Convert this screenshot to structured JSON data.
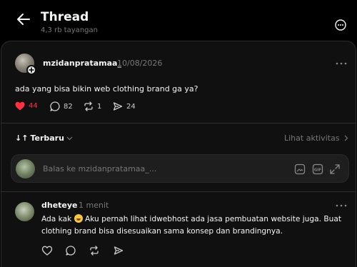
{
  "header": {
    "title": "Thread",
    "views": "4,3 rb tayangan"
  },
  "post": {
    "author": "mzidanpratamaa_",
    "date": "10/08/2026",
    "text": "ada yang bisa bikin web clothing brand ga ya?",
    "likes": "44",
    "comments": "82",
    "reposts": "1",
    "shares": "24",
    "like_color": "#ff3040"
  },
  "sort": {
    "label": "Terbaru",
    "activity_label": "Lihat aktivitas"
  },
  "reply": {
    "placeholder": "Balas ke mzidanpratamaa_..."
  },
  "comment": {
    "author": "dheteye",
    "time": "1 menit",
    "text_before_emoji": "Ada kak ",
    "text_after_emoji": " Aku pernah lihat idwebhost ada jasa pembuatan website juga. Buat clothing brand bisa disesuaikan sama konsep dan brandingnya."
  }
}
